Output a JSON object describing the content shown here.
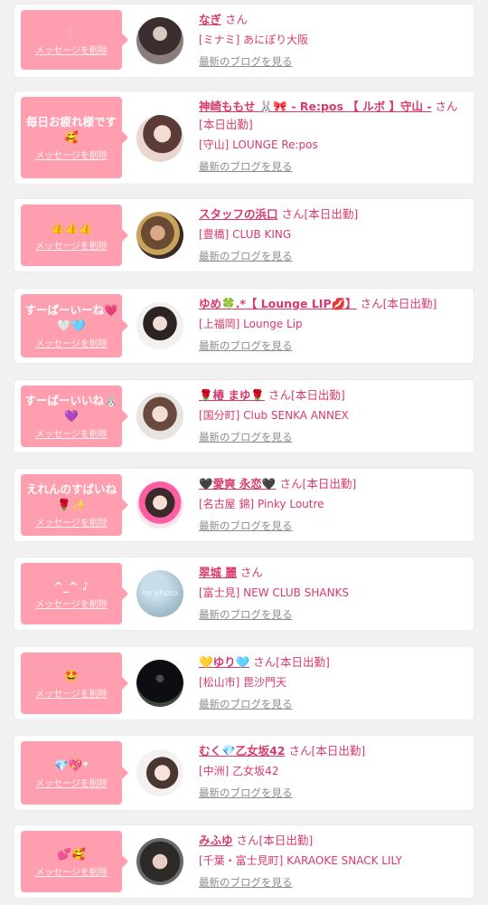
{
  "labels": {
    "delete": "メッセージを削除",
    "blog": "最新のブログを見る"
  },
  "colors": {
    "bubble": "#ff9eae",
    "accent": "#d93a6b",
    "link_gray": "#8c8c8c",
    "background": "#f1f1f1"
  },
  "items": [
    {
      "message": "♡",
      "name": "なぎ",
      "suffix": "さん",
      "shop": "[ミナミ] あにぽり大阪"
    },
    {
      "message": "毎日お疲れ様です🥰",
      "name": "神崎ももせ 🐰🎀 - Re:pos 【 ルボ 】守山 -",
      "suffix": "さん[本日出勤]",
      "shop": "[守山] LOUNGE Re:pos"
    },
    {
      "message": "👍👍👍",
      "name": "スタッフの浜口",
      "suffix": "さん[本日出勤]",
      "shop": "[豊橋] CLUB KING"
    },
    {
      "message": "すーぱーいーね💗🤍🩵",
      "name": "ゆめ🍀.*【 Lounge LIP💋】",
      "suffix": "さん[本日出勤]",
      "shop": "[上福岡] Lounge Lip"
    },
    {
      "message": "すーぱーいいね🐰💜",
      "name": "🌹椿 まゆ🌹",
      "suffix": "さん[本日出勤]",
      "shop": "[国分町] Club SENKA ANNEX"
    },
    {
      "message": "えれんのすばいね🌹✨",
      "name": "🖤愛爽 永恋🖤",
      "suffix": "さん[本日出勤]",
      "shop": "[名古屋 錦] Pinky Loutre"
    },
    {
      "message": "^_^ ♪",
      "name": "翠城 麗",
      "suffix": "さん",
      "shop": "[富士見] NEW CLUB SHANKS",
      "avatar_text": "no photo"
    },
    {
      "message": "🤩",
      "name": "💛ゆり🩵",
      "suffix": "さん[本日出勤]",
      "shop": "[松山市] 毘沙門天"
    },
    {
      "message": "💎💖*",
      "name": "むく💎乙女坂42",
      "suffix": "さん[本日出勤]",
      "shop": "[中洲] 乙女坂42"
    },
    {
      "message": "💕🥰",
      "name": "みふゆ",
      "suffix": "さん[本日出勤]",
      "shop": "[千葉・富士見町] KARAOKE SNACK LILY"
    }
  ]
}
